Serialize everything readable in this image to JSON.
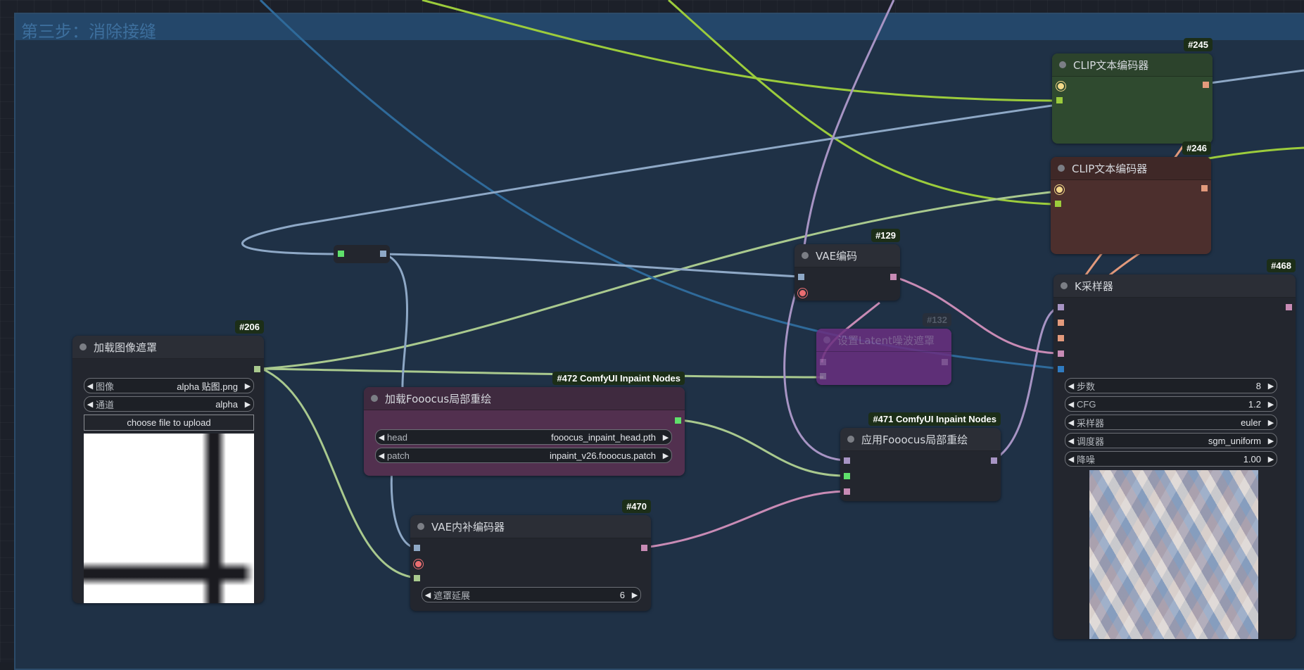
{
  "group": {
    "title": "第三步：消除接缝"
  },
  "nodes": {
    "clip1": {
      "id": "#245",
      "title": "CLIP文本编码器"
    },
    "clip2": {
      "id": "#246",
      "title": "CLIP文本编码器"
    },
    "vae_encode": {
      "id": "#129",
      "title": "VAE编码"
    },
    "latent_mask": {
      "id": "#132",
      "title": "设置Latent噪波遮罩"
    },
    "ksampler": {
      "id": "#468",
      "title": "K采样器",
      "widgets": [
        {
          "label": "步数",
          "value": "8"
        },
        {
          "label": "CFG",
          "value": "1.2"
        },
        {
          "label": "采样器",
          "value": "euler"
        },
        {
          "label": "调度器",
          "value": "sgm_uniform"
        },
        {
          "label": "降噪",
          "value": "1.00"
        }
      ]
    },
    "load_mask": {
      "id": "#206",
      "title": "加载图像遮罩",
      "widgets": [
        {
          "label": "图像",
          "value": "alpha 贴图.png"
        },
        {
          "label": "通道",
          "value": "alpha"
        }
      ],
      "upload_label": "choose file to upload"
    },
    "load_fooocus": {
      "id": "#472 ComfyUI Inpaint Nodes",
      "title": "加载Fooocus局部重绘",
      "widgets": [
        {
          "label": "head",
          "value": "fooocus_inpaint_head.pth"
        },
        {
          "label": "patch",
          "value": "inpaint_v26.fooocus.patch"
        }
      ]
    },
    "apply_fooocus": {
      "id": "#471 ComfyUI Inpaint Nodes",
      "title": "应用Fooocus局部重绘"
    },
    "vae_inpaint": {
      "id": "#470",
      "title": "VAE内补编码器",
      "widgets": [
        {
          "label": "遮罩延展",
          "value": "6"
        }
      ]
    }
  },
  "colors": {
    "accent_green": "#9ccc3c",
    "link_blue": "#2f6a9a",
    "link_lightblue": "#8ea8c6",
    "link_lavender": "#a794c4",
    "link_pink": "#c88bb5",
    "link_mint": "#a9c98e",
    "clip_green_node": "#2f4a2f",
    "clip_red_node": "#4c2f2d",
    "fooocus_node": "#52304f"
  }
}
